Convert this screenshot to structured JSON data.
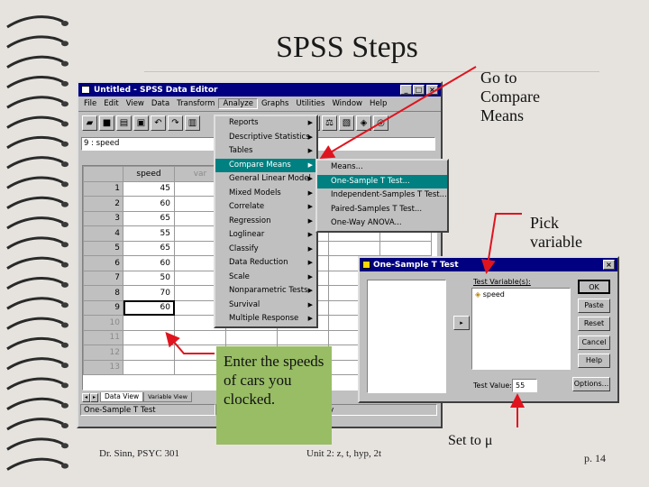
{
  "slide": {
    "title": "SPSS Steps",
    "footer_left": "Dr. Sinn, PSYC 301",
    "footer_center": "Unit 2: z, t, hyp, 2t",
    "footer_right": "p. 14"
  },
  "callouts": {
    "compare_means": "Go to\nCompare\nMeans",
    "pick_variable": "Pick\nvariable",
    "enter_speeds": "Enter the speeds of cars you clocked.",
    "set_to_mu": "Set to μ"
  },
  "editor": {
    "title": "Untitled - SPSS Data Editor",
    "menu": [
      "File",
      "Edit",
      "View",
      "Data",
      "Transform",
      "Analyze",
      "Graphs",
      "Utilities",
      "Window",
      "Help"
    ],
    "active_menu": "Analyze",
    "cell_ref": "9 : speed",
    "cell_value": "6",
    "columns": [
      "speed",
      "var"
    ],
    "rows": [
      {
        "n": "1",
        "speed": "45"
      },
      {
        "n": "2",
        "speed": "60"
      },
      {
        "n": "3",
        "speed": "65"
      },
      {
        "n": "4",
        "speed": "55"
      },
      {
        "n": "5",
        "speed": "65"
      },
      {
        "n": "6",
        "speed": "60"
      },
      {
        "n": "7",
        "speed": "50"
      },
      {
        "n": "8",
        "speed": "70"
      },
      {
        "n": "9",
        "speed": "60"
      },
      {
        "n": "10",
        "speed": ""
      },
      {
        "n": "11",
        "speed": ""
      },
      {
        "n": "12",
        "speed": ""
      },
      {
        "n": "13",
        "speed": ""
      }
    ],
    "tab_data": "Data View",
    "tab_variable": "Variable View",
    "status_left": "One-Sample T Test",
    "status_right": "s ready"
  },
  "analyze_menu": [
    {
      "label": "Reports",
      "sub": true
    },
    {
      "label": "Descriptive Statistics",
      "sub": true
    },
    {
      "label": "Tables",
      "sub": true
    },
    {
      "label": "Compare Means",
      "sub": true,
      "hl": true
    },
    {
      "label": "General Linear Model",
      "sub": true
    },
    {
      "label": "Mixed Models",
      "sub": true
    },
    {
      "label": "Correlate",
      "sub": true
    },
    {
      "label": "Regression",
      "sub": true
    },
    {
      "label": "Loglinear",
      "sub": true
    },
    {
      "label": "Classify",
      "sub": true
    },
    {
      "label": "Data Reduction",
      "sub": true
    },
    {
      "label": "Scale",
      "sub": true
    },
    {
      "label": "Nonparametric Tests",
      "sub": true
    },
    {
      "label": "Survival",
      "sub": true
    },
    {
      "label": "Multiple Response",
      "sub": true
    }
  ],
  "compare_menu": [
    {
      "label": "Means..."
    },
    {
      "label": "One-Sample T Test...",
      "hl": true
    },
    {
      "label": "Independent-Samples T Test..."
    },
    {
      "label": "Paired-Samples T Test..."
    },
    {
      "label": "One-Way ANOVA..."
    }
  ],
  "dialog": {
    "title": "One-Sample T Test",
    "test_vars_label": "Test Variable(s):",
    "test_var": "speed",
    "test_value_label": "Test Value:",
    "test_value": "55",
    "buttons": {
      "ok": "OK",
      "paste": "Paste",
      "reset": "Reset",
      "cancel": "Cancel",
      "help": "Help",
      "options": "Options..."
    }
  },
  "colors": {
    "arrow": "#e0141e",
    "green_box": "#98bd65",
    "menu_highlight": "#008080",
    "titlebar": "#000080"
  }
}
